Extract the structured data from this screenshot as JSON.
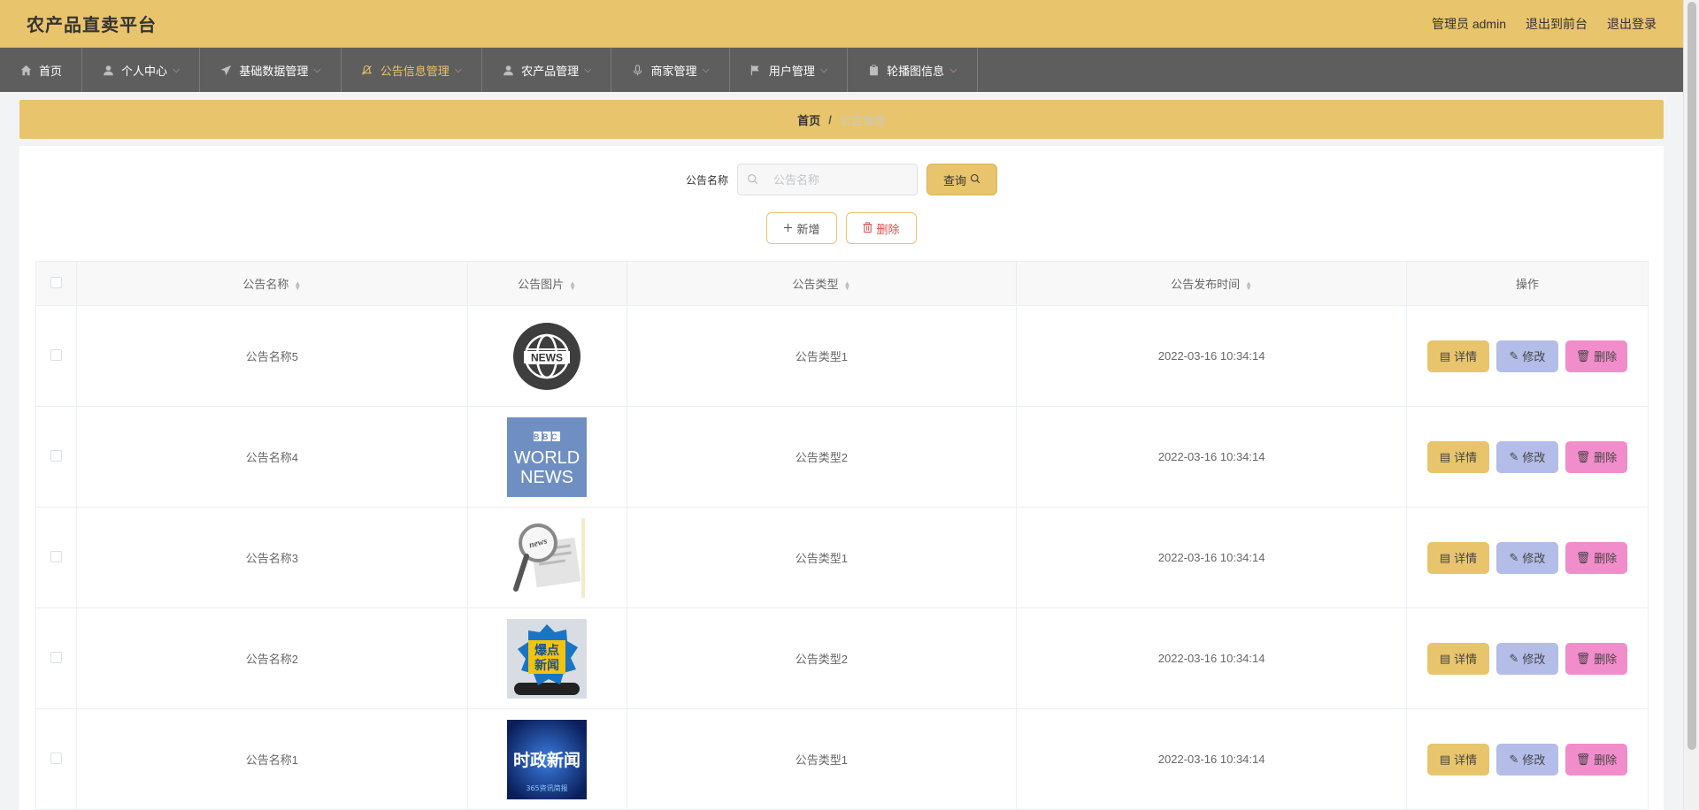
{
  "header": {
    "title": "农产品直卖平台",
    "admin_label": "管理员 admin",
    "front_label": "退出到前台",
    "logout_label": "退出登录"
  },
  "nav": {
    "items": [
      {
        "label": "首页",
        "icon": "home-icon",
        "caret": false
      },
      {
        "label": "个人中心",
        "icon": "user-icon",
        "caret": true
      },
      {
        "label": "基础数据管理",
        "icon": "send-icon",
        "caret": true
      },
      {
        "label": "公告信息管理",
        "icon": "bell-off-icon",
        "caret": true,
        "active": true
      },
      {
        "label": "农产品管理",
        "icon": "user-icon",
        "caret": true
      },
      {
        "label": "商家管理",
        "icon": "mic-icon",
        "caret": true
      },
      {
        "label": "用户管理",
        "icon": "flag-icon",
        "caret": true
      },
      {
        "label": "轮播图信息",
        "icon": "clipboard-icon",
        "caret": true
      }
    ]
  },
  "breadcrumb": {
    "home": "首页",
    "separator": "/",
    "current": "公告信息"
  },
  "search": {
    "label": "公告名称",
    "placeholder": "公告名称",
    "value": "",
    "button_label": "查询"
  },
  "actions": {
    "add_label": "新增",
    "delete_label": "删除"
  },
  "table": {
    "columns": [
      "公告名称",
      "公告图片",
      "公告类型",
      "公告发布时间",
      "操作"
    ],
    "rows": [
      {
        "name": "公告名称5",
        "image": "news-globe",
        "type": "公告类型1",
        "time": "2022-03-16 10:34:14"
      },
      {
        "name": "公告名称4",
        "image": "bbc-world-news",
        "type": "公告类型2",
        "time": "2022-03-16 10:34:14"
      },
      {
        "name": "公告名称3",
        "image": "magnifier-news",
        "type": "公告类型1",
        "time": "2022-03-16 10:34:14"
      },
      {
        "name": "公告名称2",
        "image": "baodian-xinwen",
        "type": "公告类型2",
        "time": "2022-03-16 10:34:14"
      },
      {
        "name": "公告名称1",
        "image": "shizheng-xinwen",
        "type": "公告类型1",
        "time": "2022-03-16 10:34:14"
      }
    ],
    "row_actions": {
      "detail_label": "详情",
      "edit_label": "修改",
      "delete_label": "删除"
    }
  },
  "image_text": {
    "news_globe": "NEWS",
    "bbc_logo": "BBC",
    "bbc_line1": "WORLD",
    "bbc_line2": "NEWS",
    "magnifier": "news",
    "baodian_1": "爆点",
    "baodian_2": "新闻",
    "shizheng": "时政新闻",
    "shizheng_sub": "365资讯简报"
  },
  "colors": {
    "accent": "#e8c46c",
    "nav_bg": "#5e5e5e",
    "detail_btn": "#e8c46c",
    "edit_btn": "#b3bde8",
    "delete_btn": "#f28dcb",
    "danger_text": "#e04b4b"
  }
}
